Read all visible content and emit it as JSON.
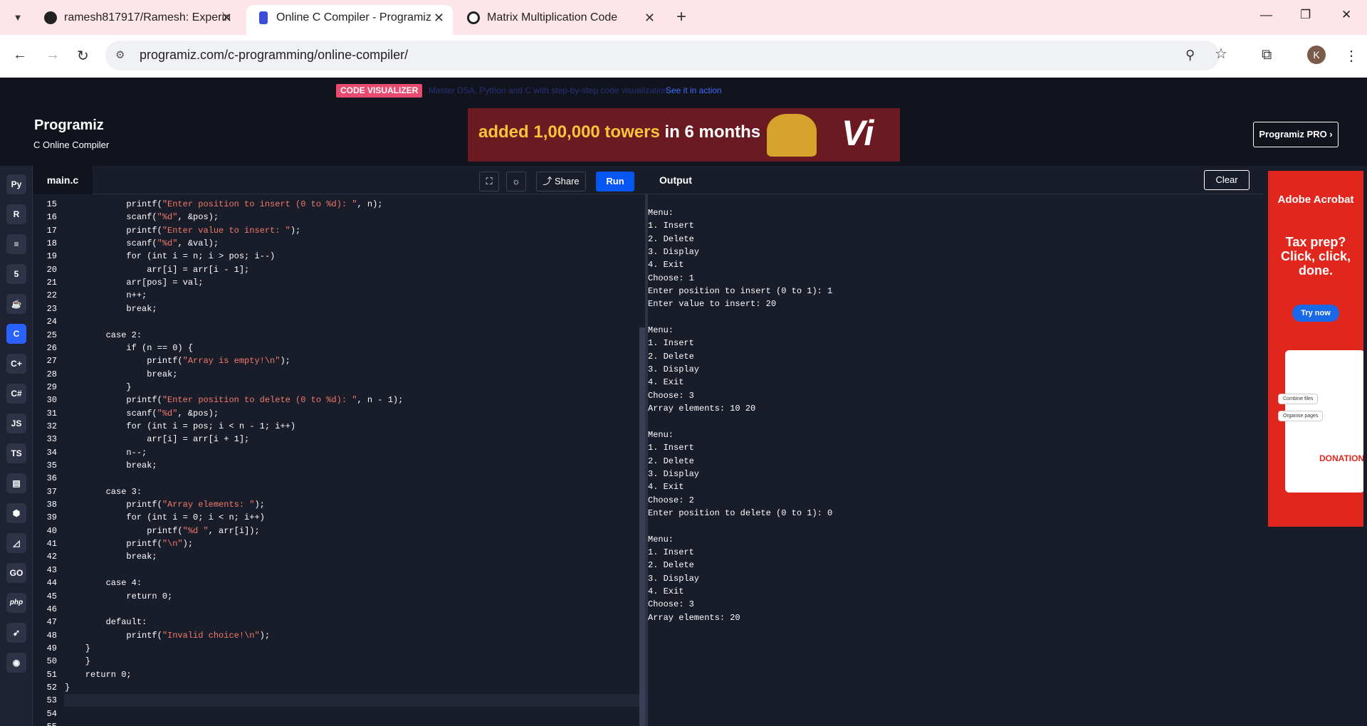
{
  "browser": {
    "tabs": [
      {
        "title": "ramesh817917/Ramesh: Experin"
      },
      {
        "title": "Online C Compiler - Programiz"
      },
      {
        "title": "Matrix Multiplication Code"
      }
    ],
    "url": "programiz.com/c-programming/online-compiler/",
    "profile_initial": "K",
    "accent": "#fde5ea"
  },
  "promo": {
    "badge": "CODE VISUALIZER",
    "text": "Master DSA, Python and C with step-by-step code visualization.",
    "link": "See it in action"
  },
  "header": {
    "logo": "Programiz",
    "subtitle": "C Online Compiler",
    "ad_text_highlight": "added 1,00,000 towers",
    "ad_text_rest": " in 6 months",
    "ad_brand": "Vi",
    "pro_button": "Programiz PRO ›"
  },
  "languages": [
    "python-icon",
    "r-icon",
    "sql-icon",
    "html-icon",
    "java-icon",
    "c-icon",
    "cpp-icon",
    "csharp-icon",
    "JS",
    "TS",
    "rust-icon",
    "kotlin-icon",
    "swift-ish-icon",
    "GO",
    "php",
    "swift-icon",
    "dart-icon"
  ],
  "editor": {
    "file_tab": "main.c",
    "share_label": "Share",
    "run_label": "Run",
    "lines": [
      {
        "n": "15",
        "c": "            printf(\"Enter position to insert (0 to %d): \", n);"
      },
      {
        "n": "16",
        "c": "            scanf(\"%d\", &pos);"
      },
      {
        "n": "17",
        "c": "            printf(\"Enter value to insert: \");"
      },
      {
        "n": "18",
        "c": "            scanf(\"%d\", &val);"
      },
      {
        "n": "19",
        "c": "            for (int i = n; i > pos; i--)"
      },
      {
        "n": "20",
        "c": "                arr[i] = arr[i - 1];"
      },
      {
        "n": "21",
        "c": "            arr[pos] = val;"
      },
      {
        "n": "22",
        "c": "            n++;"
      },
      {
        "n": "23",
        "c": "            break;"
      },
      {
        "n": "24",
        "c": ""
      },
      {
        "n": "25",
        "c": "        case 2:"
      },
      {
        "n": "26",
        "c": "            if (n == 0) {"
      },
      {
        "n": "27",
        "c": "                printf(\"Array is empty!\\n\");"
      },
      {
        "n": "28",
        "c": "                break;"
      },
      {
        "n": "29",
        "c": "            }"
      },
      {
        "n": "30",
        "c": "            printf(\"Enter position to delete (0 to %d): \", n - 1);"
      },
      {
        "n": "31",
        "c": "            scanf(\"%d\", &pos);"
      },
      {
        "n": "32",
        "c": "            for (int i = pos; i < n - 1; i++)"
      },
      {
        "n": "33",
        "c": "                arr[i] = arr[i + 1];"
      },
      {
        "n": "34",
        "c": "            n--;"
      },
      {
        "n": "35",
        "c": "            break;"
      },
      {
        "n": "36",
        "c": ""
      },
      {
        "n": "37",
        "c": "        case 3:"
      },
      {
        "n": "38",
        "c": "            printf(\"Array elements: \");"
      },
      {
        "n": "39",
        "c": "            for (int i = 0; i < n; i++)"
      },
      {
        "n": "40",
        "c": "                printf(\"%d \", arr[i]);"
      },
      {
        "n": "41",
        "c": "            printf(\"\\n\");"
      },
      {
        "n": "42",
        "c": "            break;"
      },
      {
        "n": "43",
        "c": ""
      },
      {
        "n": "44",
        "c": "        case 4:"
      },
      {
        "n": "45",
        "c": "            return 0;"
      },
      {
        "n": "46",
        "c": ""
      },
      {
        "n": "47",
        "c": "        default:"
      },
      {
        "n": "48",
        "c": "            printf(\"Invalid choice!\\n\");"
      },
      {
        "n": "49",
        "c": "    }"
      },
      {
        "n": "50",
        "c": "    }"
      },
      {
        "n": "51",
        "c": "    return 0;"
      },
      {
        "n": "52",
        "c": "}"
      },
      {
        "n": "53",
        "c": ""
      },
      {
        "n": "54",
        "c": ""
      },
      {
        "n": "55",
        "c": ""
      }
    ]
  },
  "output": {
    "title": "Output",
    "clear_label": "Clear",
    "text": "Menu:\n1. Insert\n2. Delete\n3. Display\n4. Exit\nChoose: 1\nEnter position to insert (0 to 1): 1\nEnter value to insert: 20\n\nMenu:\n1. Insert\n2. Delete\n3. Display\n4. Exit\nChoose: 3\nArray elements: 10 20\n\nMenu:\n1. Insert\n2. Delete\n3. Display\n4. Exit\nChoose: 2\nEnter position to delete (0 to 1): 0\n\nMenu:\n1. Insert\n2. Delete\n3. Display\n4. Exit\nChoose: 3\nArray elements: 20\n"
  },
  "side_ad": {
    "brand": "Adobe Acrobat",
    "tagline": "Tax prep? Click, click, done.",
    "button": "Try now",
    "chip1": "Combine files",
    "chip2": "Organise pages",
    "doc_text": "DONATION"
  }
}
